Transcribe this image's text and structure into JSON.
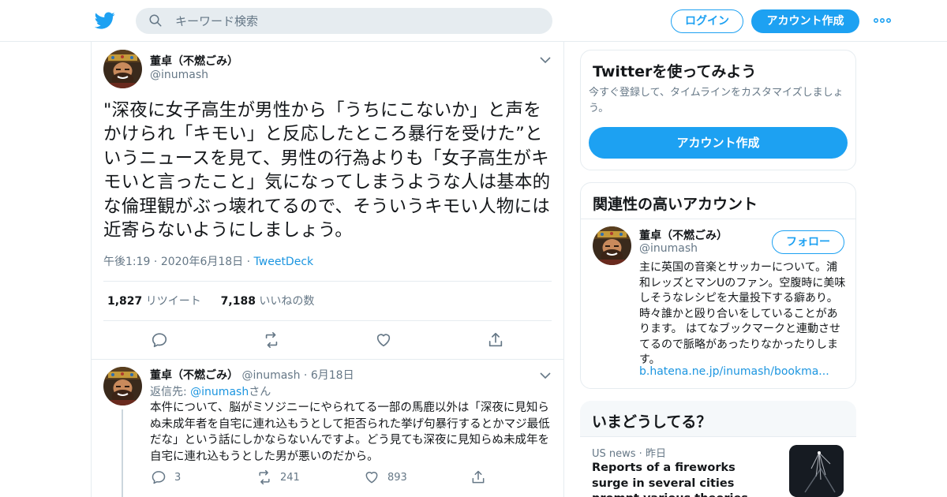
{
  "header": {
    "search_placeholder": "キーワード検索",
    "login": "ログイン",
    "signup": "アカウント作成"
  },
  "tweet": {
    "author_name": "董卓（不燃ごみ）",
    "author_handle": "@inumash",
    "text": "\"深夜に女子高生が男性から「うちにこないか」と声をかけられ「キモい」と反応したところ暴行を受けた”というニュースを見て、男性の行為よりも「女子高生がキモいと言ったこと」気になってしまうような人は基本的な倫理観がぶっ壊れてるので、そういうキモい人物には近寄らないようにしましょう。",
    "time": "午後1:19",
    "date": "2020年6月18日",
    "source": "TweetDeck",
    "retweets": "1,827",
    "retweets_label": "リツイート",
    "likes": "7,188",
    "likes_label": "いいねの数"
  },
  "reply": {
    "author_name": "董卓（不燃ごみ）",
    "author_handle": "@inumash",
    "date": "6月18日",
    "reply_to_prefix": "返信先: ",
    "reply_to_handle": "@inumash",
    "reply_to_suffix": "さん",
    "text": "本件について、脳がミソジニーにやられてる一部の馬鹿以外は「深夜に見知らぬ未成年者を自宅に連れ込もうとして拒否られた挙げ句暴行するとかマジ最低だな」という話にしかならないんですよ。どう見ても深夜に見知らぬ未成年を自宅に連れ込もうとした男が悪いのだから。",
    "replies": "3",
    "retweets": "241",
    "likes": "893"
  },
  "signup_card": {
    "title": "Twitterを使ってみよう",
    "desc": "今すぐ登録して、タイムラインをカスタマイズしましょう。",
    "button": "アカウント作成"
  },
  "related_card": {
    "title": "関連性の高いアカウント",
    "name": "董卓（不燃ごみ）",
    "handle": "@inumash",
    "follow": "フォロー",
    "bio": "主に英国の音楽とサッカーについて。浦和レッズとマンUのファン。空腹時に美味しそうなレシピを大量投下する癖あり。 時々誰かと殴り合いをしていることがあります。 はてなブックマークと連動させてるので脈略があったりなかったりします。",
    "link": "b.hatena.ne.jp/inumash/bookma..."
  },
  "trends_card": {
    "title": "いまどうしてる？",
    "category": "US news",
    "when": "昨日",
    "headline": "Reports of a fireworks surge in several cities prompt various theories"
  },
  "colors": {
    "accent": "#1da1f2",
    "link": "#1b95e0",
    "muted": "#657786",
    "border": "#e6ecf0"
  }
}
